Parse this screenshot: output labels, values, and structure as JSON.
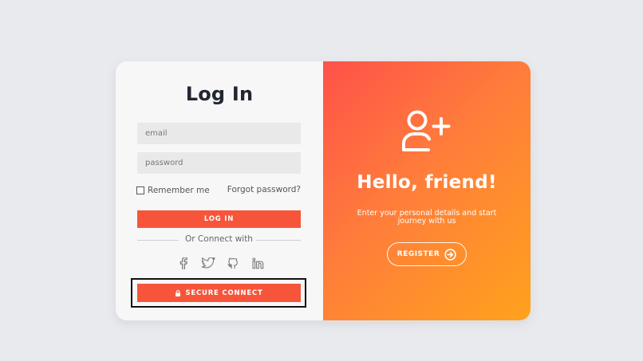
{
  "login": {
    "title": "Log In",
    "email_placeholder": "email",
    "password_placeholder": "password",
    "remember_label": "Remember me",
    "forgot_label": "Forgot password?",
    "login_button": "LOG IN",
    "connect_with": "Or Connect with",
    "secure_connect": "SECURE CONNECT"
  },
  "socials": [
    {
      "name": "facebook-icon"
    },
    {
      "name": "twitter-icon"
    },
    {
      "name": "github-icon"
    },
    {
      "name": "linkedin-icon"
    }
  ],
  "welcome": {
    "title": "Hello, friend!",
    "description": "Enter your personal details and start journey with us",
    "register_button": "REGISTER"
  },
  "colors": {
    "page_bg": "#e9eaee",
    "accent": "#f6553a",
    "gradient_start": "#ff5149",
    "gradient_end": "#ffa21c"
  }
}
